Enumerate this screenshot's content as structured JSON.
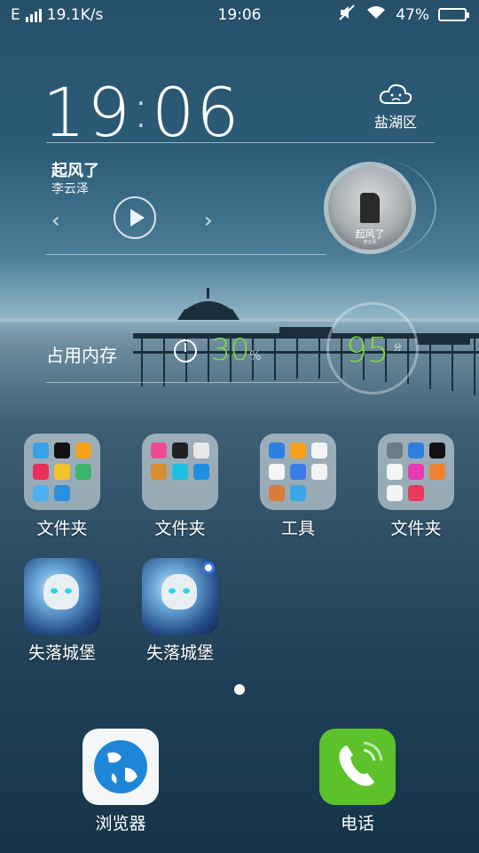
{
  "status": {
    "network": "E",
    "speed": "19.1K/s",
    "time": "19:06",
    "battery": "47%"
  },
  "clock": {
    "hours": "19",
    "minutes": "06"
  },
  "weather": {
    "location": "盐湖区"
  },
  "music": {
    "title": "起风了",
    "artist": "李云泽",
    "disc_title": "起风了",
    "disc_sub": "李云泽"
  },
  "memory": {
    "label": "占用内存",
    "percent": "30",
    "unit": "%"
  },
  "score": {
    "value": "95",
    "unit": "分"
  },
  "apps": [
    {
      "label": "文件夹"
    },
    {
      "label": "文件夹"
    },
    {
      "label": "工具"
    },
    {
      "label": "文件夹"
    },
    {
      "label": "失落城堡"
    },
    {
      "label": "失落城堡"
    }
  ],
  "dock": [
    {
      "label": "浏览器"
    },
    {
      "label": "电话"
    }
  ],
  "colors": {
    "accent_green": "#7fdc3a",
    "phone_green": "#5cc12a",
    "browser_blue": "#1e86d6"
  }
}
